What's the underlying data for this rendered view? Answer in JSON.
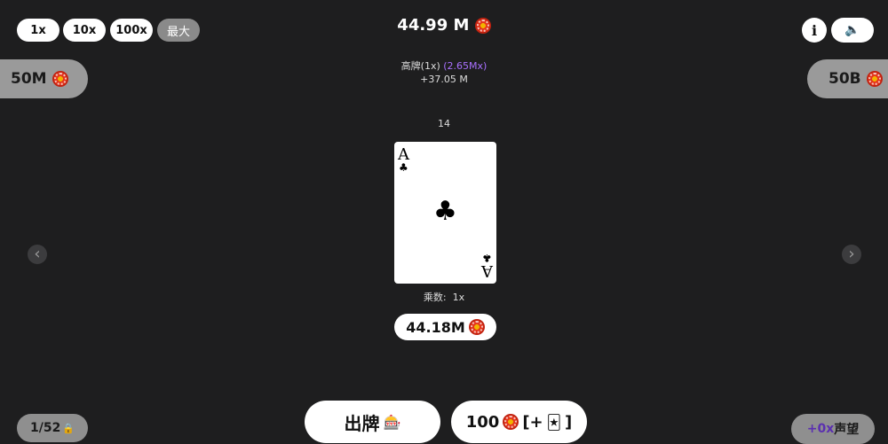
{
  "multipliers": [
    "1x",
    "10x",
    "100x"
  ],
  "max_label": "最大",
  "balance": "44.99 M",
  "hand_name": "高牌(1x)",
  "hand_mult": "(2.65Mx)",
  "gain": "+37.05 M",
  "left_bet": "50M",
  "right_bet": "50B",
  "counter": "14",
  "card": {
    "rank": "A",
    "suit": "♣"
  },
  "multiplier_label": "乘数:",
  "multiplier_value": "1x",
  "card_value": "44.18M",
  "info_label": "i",
  "sound_icon": "🔈",
  "deck_count": "1/52",
  "lock_icon": "🔒",
  "play_label": "出牌",
  "slot_icon": "🎰",
  "buy_amount": "100",
  "buy_open": "[+",
  "buy_close": "]",
  "joker_icon": "🃏",
  "fame_amount": "+0x",
  "fame_label": "声望",
  "prev_arrow": "‹",
  "next_arrow": "›",
  "colors": {
    "accent_purple": "#a970ff",
    "fame_purple": "#5b2fb0",
    "bg": "#1e1e1f"
  }
}
